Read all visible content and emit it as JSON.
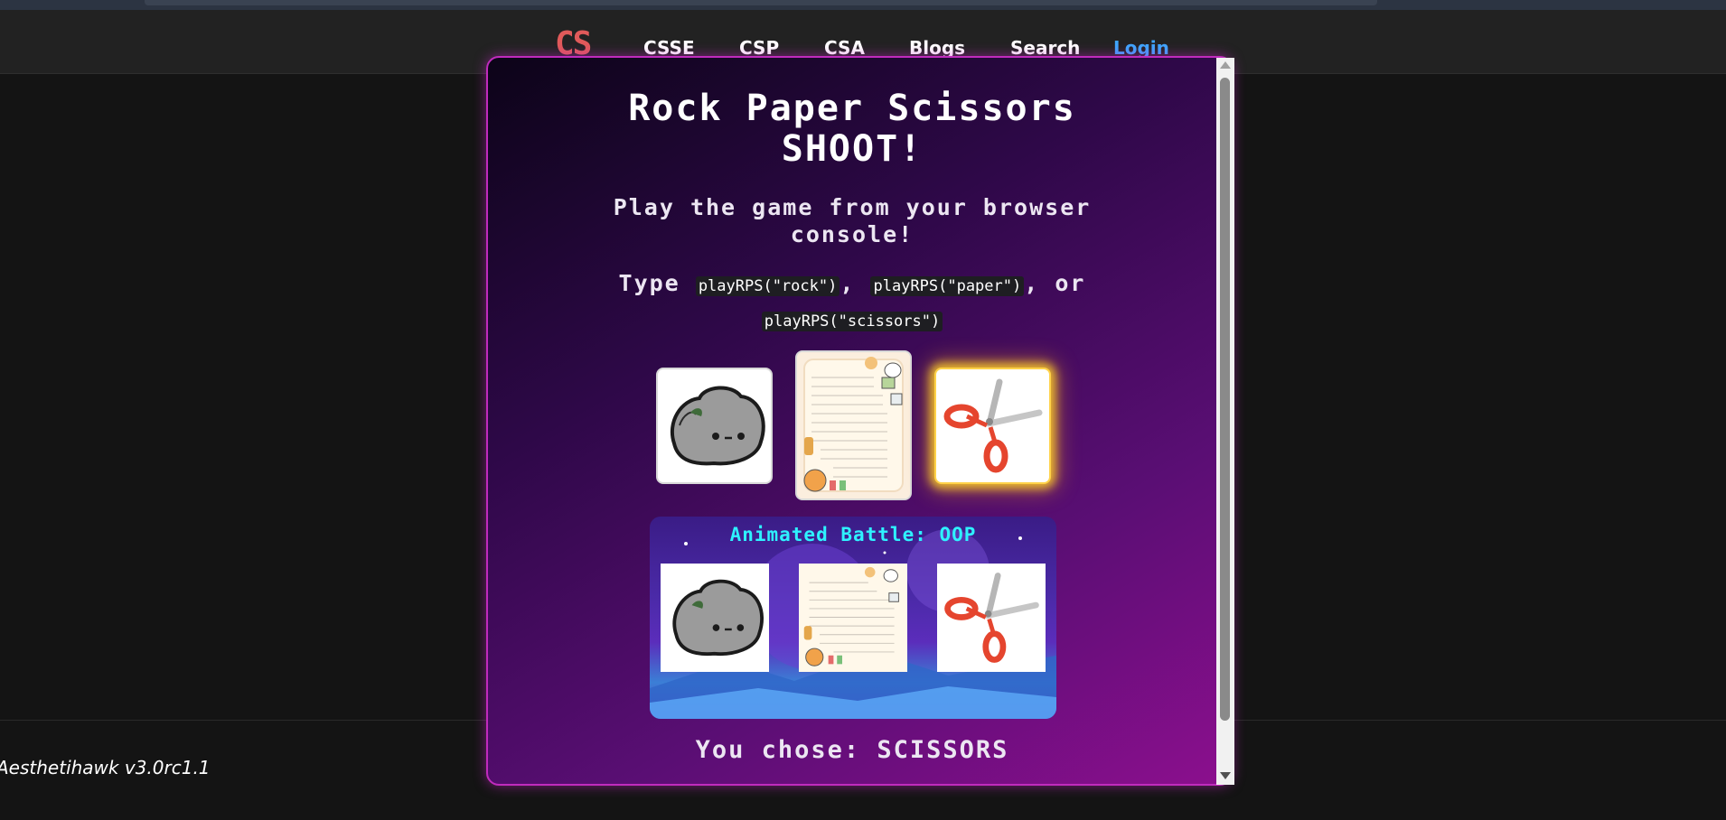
{
  "nav": {
    "logo": "CS",
    "links": [
      "CSSE",
      "CSP",
      "CSA",
      "Blogs",
      "Search"
    ],
    "login": "Login"
  },
  "game": {
    "title_line1": "Rock Paper Scissors",
    "title_line2": "SHOOT!",
    "subtitle_line1": "Play the game from your browser",
    "subtitle_line2": "console!",
    "instr_type": "Type",
    "instr_rock": "playRPS(\"rock\")",
    "instr_comma1": ",",
    "instr_paper": "playRPS(\"paper\")",
    "instr_or": ", or",
    "instr_scissors": "playRPS(\"scissors\")",
    "choices": [
      "rock",
      "paper",
      "scissors"
    ],
    "selected_choice": "scissors",
    "battle_title": "Animated Battle: OOP",
    "result_label": "You chose:",
    "result_value": "SCISSORS"
  },
  "footer": {
    "version": "Aesthetihawk v3.0rc1.1"
  },
  "colors": {
    "logo": "#e05a5a",
    "login": "#3ea6ff",
    "panel_border": "#c02bbd",
    "battle_title": "#2ef2ff",
    "selected_glow": "#ffd24a"
  }
}
